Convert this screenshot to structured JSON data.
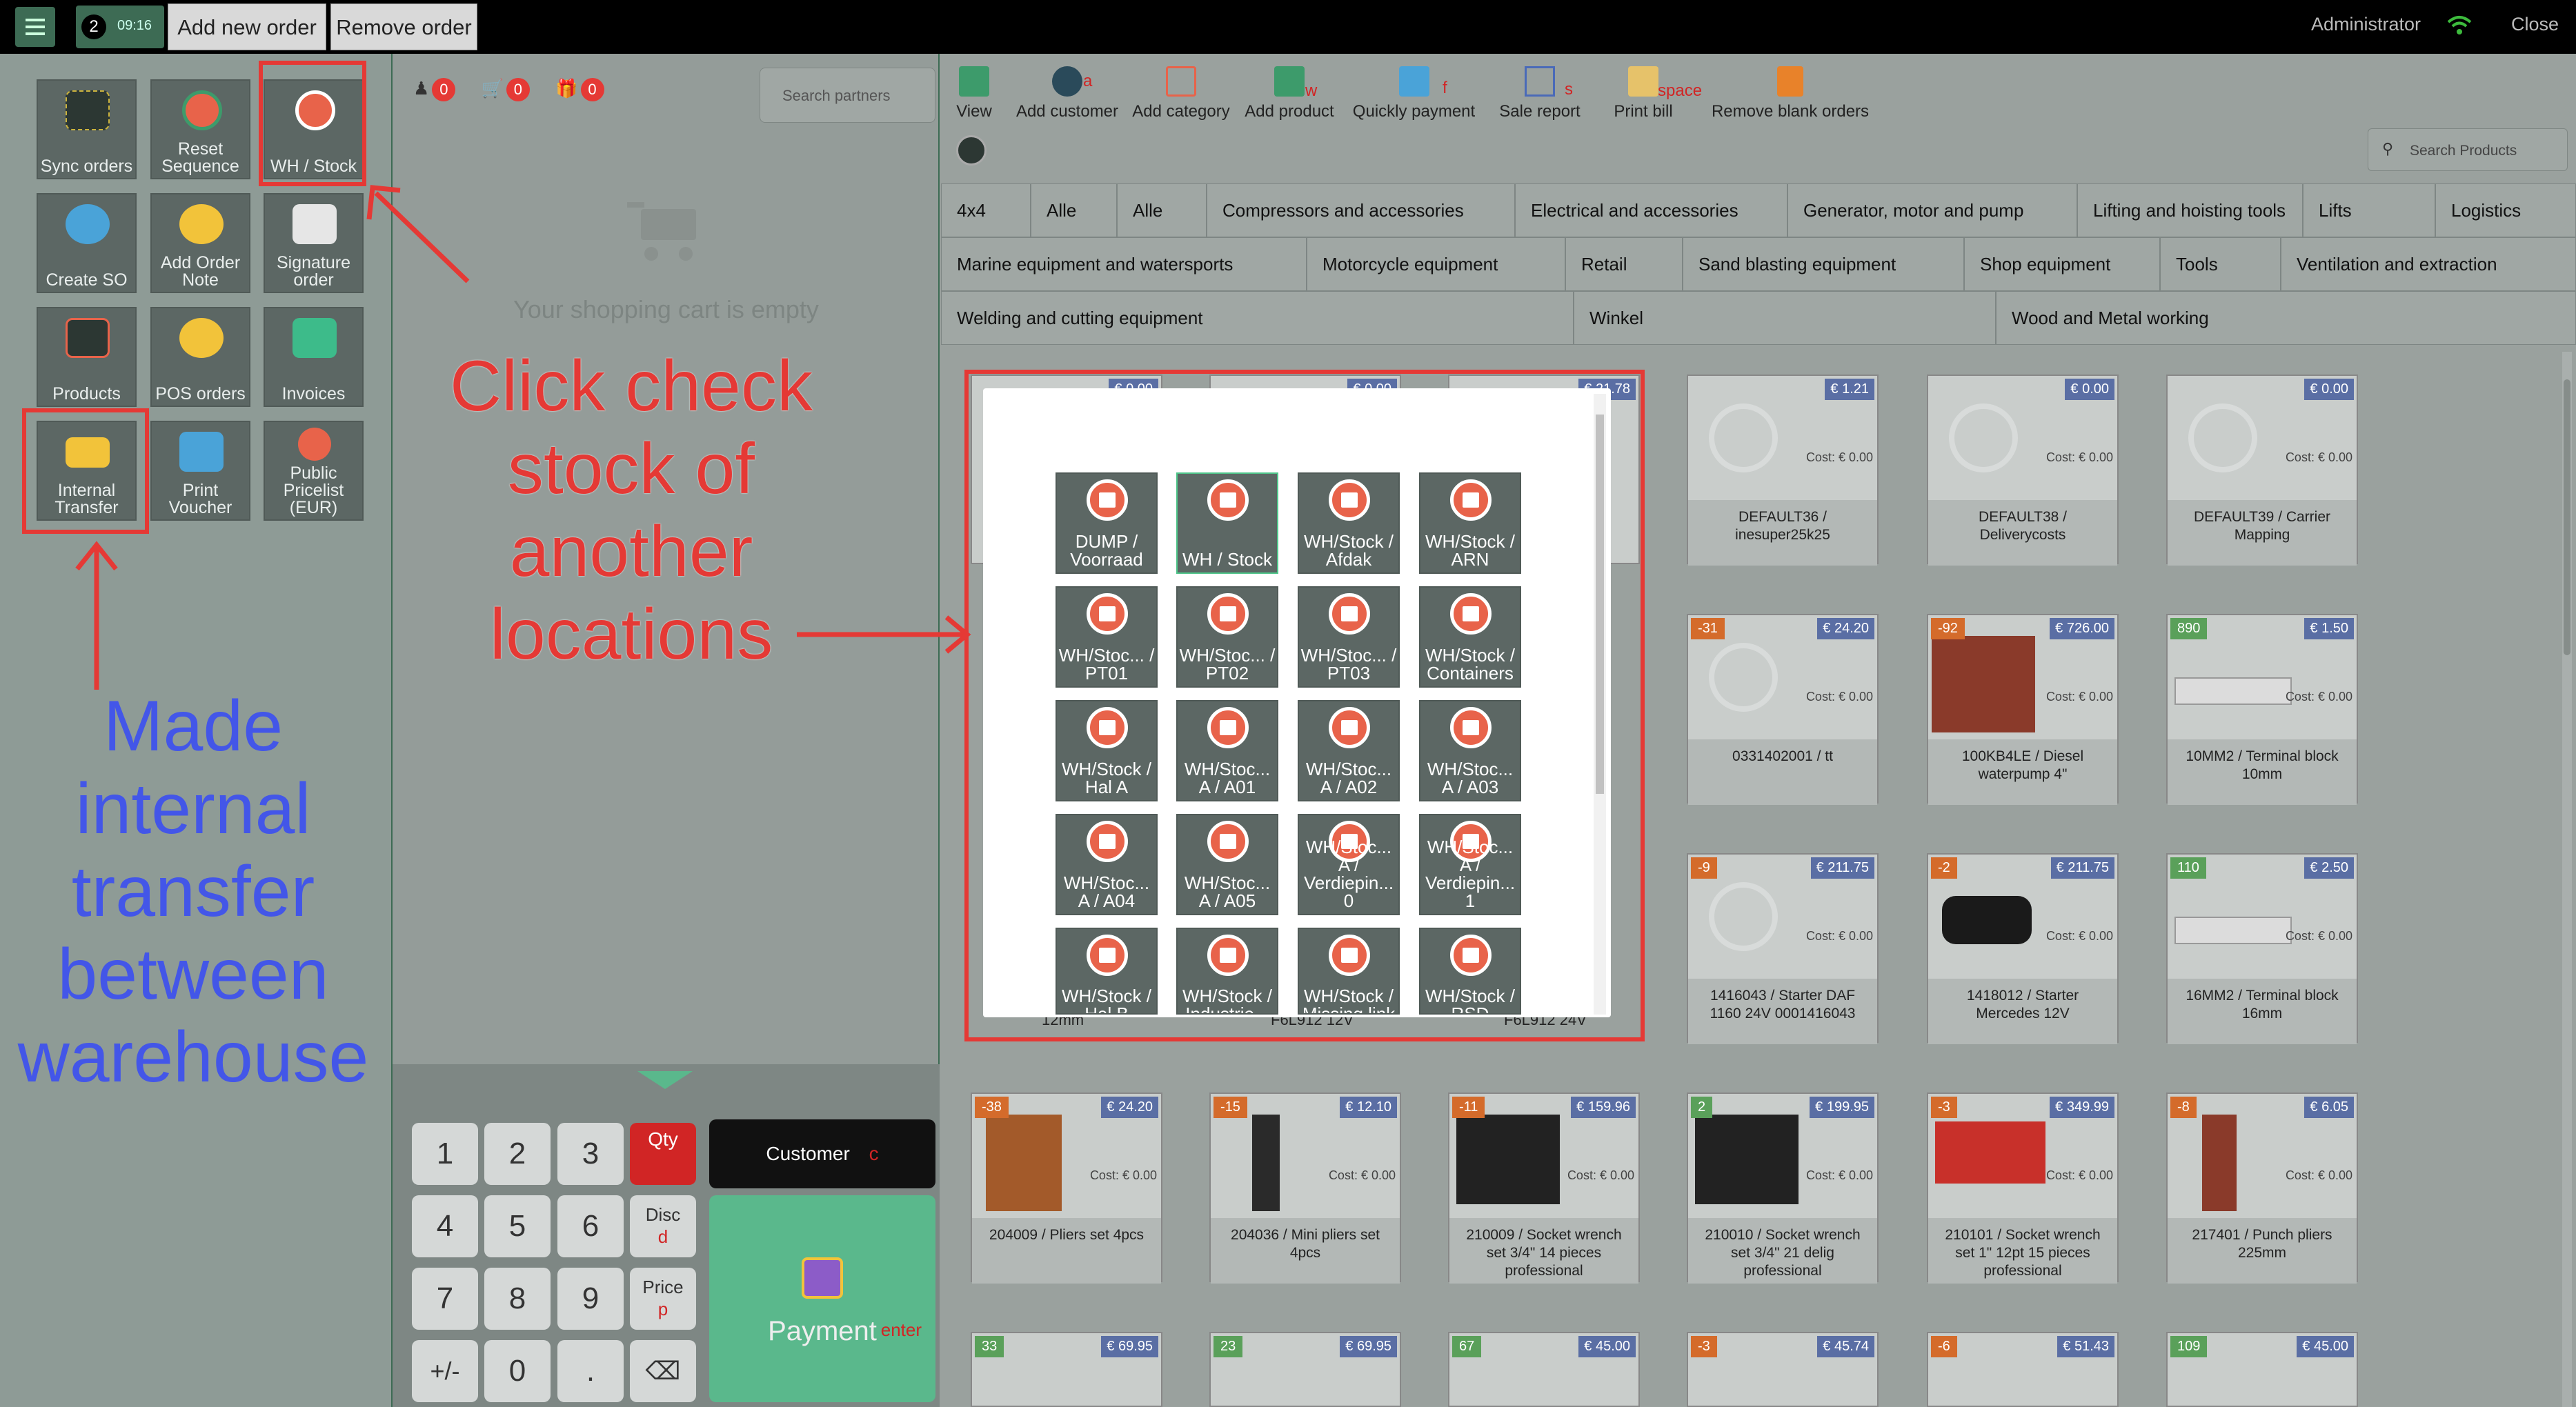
{
  "topbar": {
    "menu_icon": "list-icon",
    "order_count": "2",
    "order_time": "09:16",
    "add_order": "Add new order",
    "remove_order": "Remove order",
    "user": "Administrator",
    "close": "Close"
  },
  "left_tiles": [
    {
      "label": "Sync orders"
    },
    {
      "label": "Reset Sequence"
    },
    {
      "label": "WH / Stock"
    },
    {
      "label": "Create SO"
    },
    {
      "label": "Add Order Note"
    },
    {
      "label": "Signature order"
    },
    {
      "label": "Products"
    },
    {
      "label": "POS orders"
    },
    {
      "label": "Invoices"
    },
    {
      "label": "Internal Transfer"
    },
    {
      "label": "Print Voucher"
    },
    {
      "label": "Public Pricelist (EUR)"
    }
  ],
  "cart": {
    "counters": [
      "0",
      "0",
      "0"
    ],
    "search_placeholder": "Search partners",
    "empty_text": "Your shopping cart is empty"
  },
  "numpad": {
    "keys": [
      "1",
      "2",
      "3",
      "4",
      "5",
      "6",
      "7",
      "8",
      "9",
      "+/-",
      "0",
      "."
    ],
    "qty": "Qty",
    "disc": "Disc",
    "disc_hint": "d",
    "price": "Price",
    "price_hint": "p",
    "customer": "Customer",
    "customer_hint": "c",
    "payment": "Payment",
    "payment_hint": "enter"
  },
  "toolbar": [
    {
      "label": "View",
      "hint": ""
    },
    {
      "label": "Add customer",
      "hint": "a"
    },
    {
      "label": "Add category",
      "hint": ""
    },
    {
      "label": "Add product",
      "hint": "w"
    },
    {
      "label": "Quickly payment",
      "hint": "f"
    },
    {
      "label": "Sale report",
      "hint": "s"
    },
    {
      "label": "Print bill",
      "hint": "space"
    },
    {
      "label": "Remove blank orders",
      "hint": ""
    }
  ],
  "search_products_placeholder": "Search Products",
  "categories": [
    "4x4",
    "Alle",
    "Alle",
    "Compressors and accessories",
    "Electrical and accessories",
    "Generator, motor and pump",
    "Lifting and hoisting tools",
    "Lifts",
    "Logistics",
    "Marine equipment and watersports",
    "Motorcycle equipment",
    "Retail",
    "Sand blasting equipment",
    "Shop equipment",
    "Tools",
    "Ventilation and extraction",
    "Welding and cutting equipment",
    "Winkel",
    "Wood and Metal working"
  ],
  "products": [
    {
      "price": "€ 1.21",
      "badge": "",
      "cost": "Cost: € 0.00",
      "name": "DEFAULT36 / inesuper25k25"
    },
    {
      "price": "€ 0.00",
      "badge": "",
      "cost": "Cost: € 0.00",
      "name": "DEFAULT38 / Deliverycosts"
    },
    {
      "price": "€ 0.00",
      "badge": "",
      "cost": "Cost: € 0.00",
      "name": "DEFAULT39 / Carrier Mapping"
    },
    {
      "price": "€ 24.20",
      "badge": "-31",
      "cost": "Cost: € 0.00",
      "name": "0331402001 / tt"
    },
    {
      "price": "€ 726.00",
      "badge": "-92",
      "cost": "Cost: € 0.00",
      "name": "100KB4LE / Diesel waterpump 4\""
    },
    {
      "price": "€ 1.50",
      "badge": "890",
      "cost": "Cost: € 0.00",
      "name": "10MM2 / Terminal block 10mm"
    },
    {
      "price": "€ 211.75",
      "badge": "-9",
      "cost": "Cost: € 0.00",
      "name": "1416043 / Starter DAF 1160 24V 0001416043"
    },
    {
      "price": "€ 211.75",
      "badge": "-2",
      "cost": "Cost: € 0.00",
      "name": "1418012 / Starter Mercedes 12V"
    },
    {
      "price": "€ 2.50",
      "badge": "110",
      "cost": "Cost: € 0.00",
      "name": "16MM2 / Terminal block 16mm"
    },
    {
      "price": "€ 24.20",
      "badge": "-38",
      "cost": "Cost: € 0.00",
      "name": "204009 / Pliers set 4pcs"
    },
    {
      "price": "€ 12.10",
      "badge": "-15",
      "cost": "Cost: € 0.00",
      "name": "204036 / Mini pliers set 4pcs"
    },
    {
      "price": "€ 159.96",
      "badge": "-11",
      "cost": "Cost: € 0.00",
      "name": "210009 / Socket wrench set 3/4\" 14 pieces professional"
    },
    {
      "price": "€ 199.95",
      "badge": "2",
      "cost": "Cost: € 0.00",
      "name": "210010 / Socket wrench set 3/4\" 21 delig professional"
    },
    {
      "price": "€ 349.99",
      "badge": "-3",
      "cost": "Cost: € 0.00",
      "name": "210101 / Socket wrench set 1\" 12pt 15 pieces professional"
    },
    {
      "price": "€ 6.05",
      "badge": "-8",
      "cost": "Cost: € 0.00",
      "name": "217401 / Punch pliers 225mm"
    },
    {
      "price": "€ 69.95",
      "badge": "33",
      "cost": "",
      "name": ""
    },
    {
      "price": "€ 69.95",
      "badge": "23",
      "cost": "",
      "name": ""
    },
    {
      "price": "€ 45.00",
      "badge": "67",
      "cost": "",
      "name": ""
    },
    {
      "price": "€ 45.74",
      "badge": "-3",
      "cost": "",
      "name": ""
    },
    {
      "price": "€ 51.43",
      "badge": "-6",
      "cost": "",
      "name": ""
    },
    {
      "price": "€ 45.00",
      "badge": "109",
      "cost": "",
      "name": ""
    }
  ],
  "hidden_fragments": [
    "€ 0.00",
    "€ 0.00",
    "€ 21.78",
    "12mm",
    "F6L912 12V",
    "F6L912 24V"
  ],
  "locations": [
    "DUMP / Voorraad",
    "WH / Stock",
    "WH/Stock / Afdak",
    "WH/Stock / ARN",
    "WH/Stoc... / PT01",
    "WH/Stoc... / PT02",
    "WH/Stoc... / PT03",
    "WH/Stock / Containers",
    "WH/Stock / Hal A",
    "WH/Stoc... A / A01",
    "WH/Stoc... A / A02",
    "WH/Stoc... A / A03",
    "WH/Stoc... A / A04",
    "WH/Stoc... A / A05",
    "WH/Stoc... A / Verdiepin... 0",
    "WH/Stoc... A / Verdiepin... 1",
    "WH/Stock / Hal B",
    "WH/Stock / Industrie...",
    "WH/Stock / Missing link",
    "WH/Stock / RSD"
  ],
  "annotations": {
    "red": "Click check stock of another locations",
    "blue": "Made internal transfer between warehouse"
  },
  "colors": {
    "accent_red": "#e53935",
    "annotation_blue": "#4356e8",
    "tile_bg": "#5c6764",
    "location_icon": "#e8634a"
  }
}
